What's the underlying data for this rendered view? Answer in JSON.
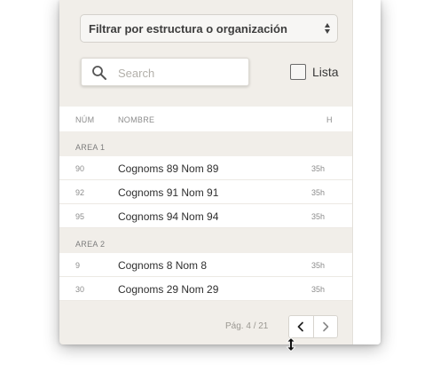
{
  "filter": {
    "selected": "Filtrar por estructura o organización"
  },
  "search": {
    "placeholder": "Search",
    "value": ""
  },
  "list_toggle": {
    "label": "Lista",
    "checked": false
  },
  "table": {
    "headers": {
      "num": "NÚM",
      "name": "NOMBRE",
      "hours": "H"
    },
    "groups": [
      {
        "label": "AREA 1",
        "rows": [
          {
            "num": "90",
            "name": "Cognoms 89 Nom 89",
            "hours": "35h"
          },
          {
            "num": "92",
            "name": "Cognoms 91 Nom 91",
            "hours": "35h"
          },
          {
            "num": "95",
            "name": "Cognoms 94 Nom 94",
            "hours": "35h"
          }
        ]
      },
      {
        "label": "AREA 2",
        "rows": [
          {
            "num": "9",
            "name": "Cognoms 8 Nom 8",
            "hours": "35h"
          },
          {
            "num": "30",
            "name": "Cognoms 29 Nom 29",
            "hours": "35h"
          }
        ]
      }
    ]
  },
  "pagination": {
    "label": "Pág. 4 / 21",
    "prev_icon": "chevron-left-icon",
    "next_icon": "chevron-right-icon"
  },
  "colors": {
    "panel_bg": "#f1eee9",
    "row_bg": "#ffffff",
    "text": "#2f2f2f",
    "muted": "#8c8c8c"
  }
}
